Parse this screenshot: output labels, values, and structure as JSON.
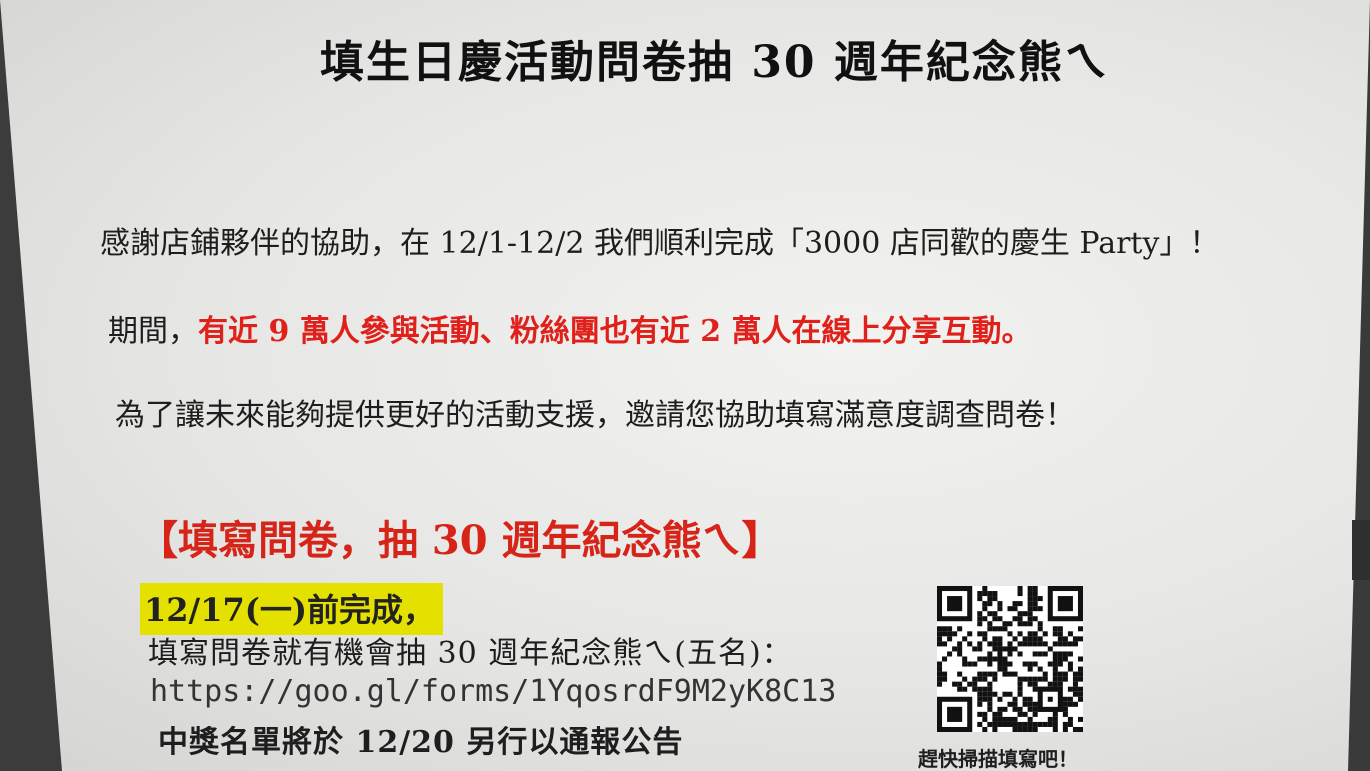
{
  "title": "填生日慶活動問卷抽 30 週年紀念熊ㄟ",
  "para1": "感謝店鋪夥伴的協助，在 12/1-12/2 我們順利完成「3000 店同歡的慶生 Party」！",
  "para2": {
    "lead": "期間，",
    "highlight": "有近 9 萬人參與活動、粉絲團也有近 2 萬人在線上分享互動。"
  },
  "para3": "為了讓未來能夠提供更好的活動支援，邀請您協助填寫滿意度調查問卷！",
  "section_heading": "【填寫問卷，抽 30 週年紀念熊ㄟ】",
  "deadline": "12/17(一)前完成，",
  "prize_line": "填寫問卷就有機會抽 30 週年紀念熊ㄟ(五名)：",
  "form_url": "https://goo.gl/forms/1YqosrdF9M2yK8C13",
  "announcement": "中獎名單將於 12/20 另行以通報公告",
  "qr_caption": "趕快掃描填寫吧！",
  "colors": {
    "accent_red": "#e0201a",
    "highlight_yellow": "#e4e100"
  }
}
